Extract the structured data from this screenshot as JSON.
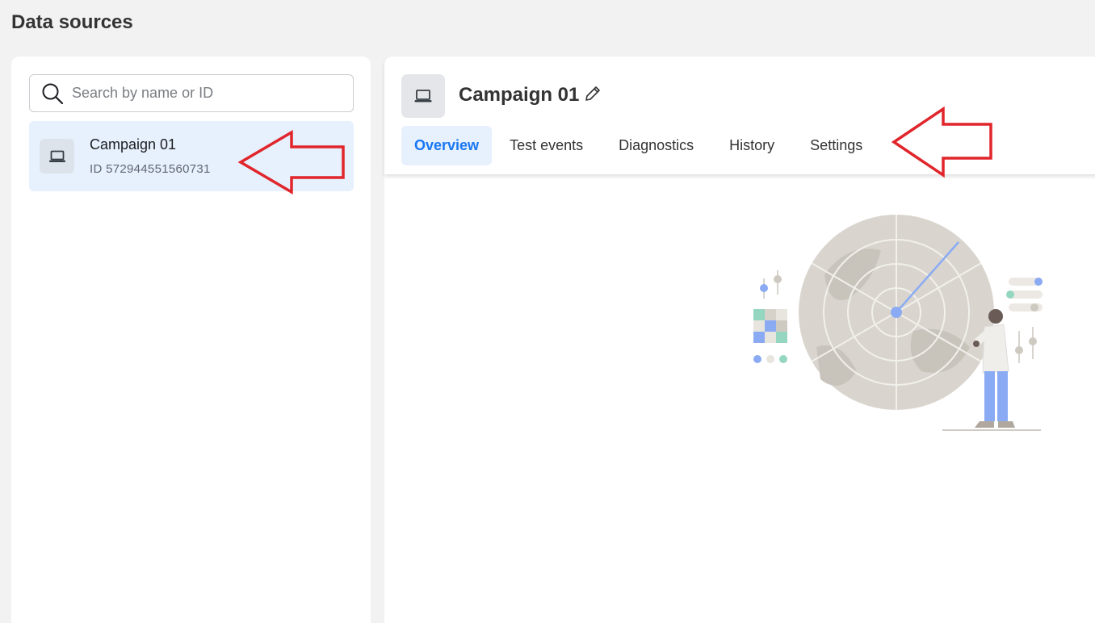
{
  "page": {
    "title": "Data sources"
  },
  "colors": {
    "accent": "#1877f2",
    "selected_bg": "#e7f0fd",
    "annotation": "#e0252b"
  },
  "search": {
    "placeholder": "Search by name or ID",
    "icon": "search-icon"
  },
  "sources": [
    {
      "name": "Campaign 01",
      "id": "ID 572944551560731",
      "icon": "laptop-icon",
      "selected": true
    }
  ],
  "detail": {
    "title": "Campaign 01",
    "icon": "laptop-icon",
    "edit_icon": "pencil-icon",
    "tabs": [
      {
        "label": "Overview",
        "active": true
      },
      {
        "label": "Test events",
        "active": false
      },
      {
        "label": "Diagnostics",
        "active": false
      },
      {
        "label": "History",
        "active": false
      },
      {
        "label": "Settings",
        "active": false
      }
    ]
  }
}
